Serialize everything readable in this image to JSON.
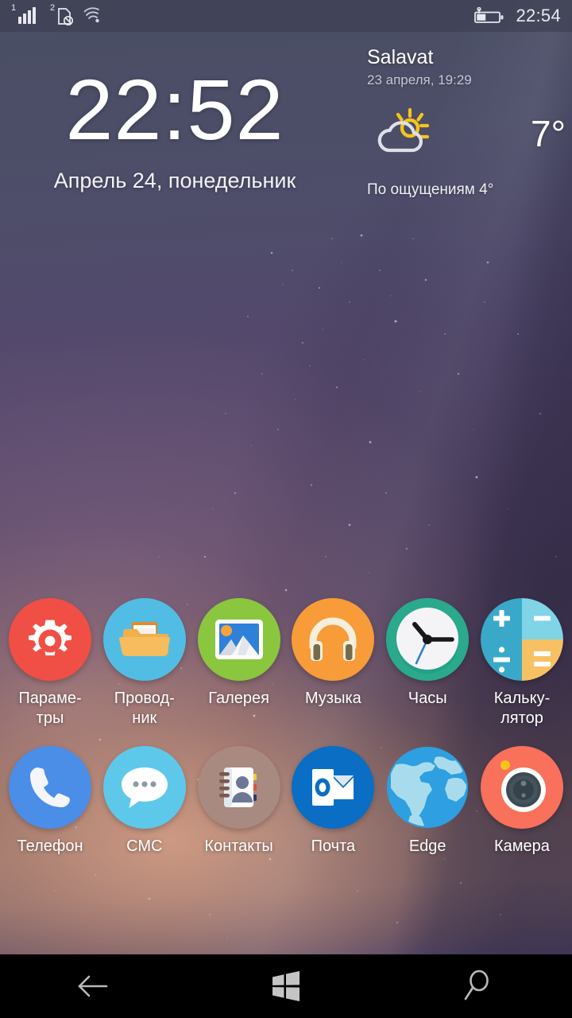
{
  "statusbar": {
    "sim1_label": "1",
    "sim2_label": "2",
    "signal_icon": "signal-bars-icon",
    "sim2_icon": "sim-no-service-icon",
    "wifi_icon": "wifi-icon",
    "battery_icon": "battery-charging-icon",
    "clock": "22:54"
  },
  "lockscreen": {
    "time": "22:52",
    "date": "Апрель 24, понедельник"
  },
  "weather": {
    "city": "Salavat",
    "observed": "23 апреля, 19:29",
    "condition_icon": "partly-cloudy-sun-icon",
    "temperature": "7°",
    "feels_like": "По ощущениям 4°"
  },
  "apps": {
    "row1": [
      {
        "name": "settings",
        "label": "Параме-\nтры",
        "icon": "gear-icon",
        "bg": "#ef4f45"
      },
      {
        "name": "explorer",
        "label": "Провод-\nник",
        "icon": "folder-icon",
        "bg": "#52bde4"
      },
      {
        "name": "gallery",
        "label": "Галерея",
        "icon": "photo-icon",
        "bg": "#8bc63f"
      },
      {
        "name": "music",
        "label": "Музыка",
        "icon": "headphones-icon",
        "bg": "#f79c38"
      },
      {
        "name": "clock",
        "label": "Часы",
        "icon": "analog-clock-icon",
        "bg": "#2aa municipal"
      },
      {
        "name": "calculator",
        "label": "Кальку-\nлятор",
        "icon": "calculator-icon",
        "bg": "#3fb2d6"
      }
    ],
    "row2": [
      {
        "name": "phone",
        "label": "Телефон",
        "icon": "phone-handset-icon",
        "bg": "#4a8ee8"
      },
      {
        "name": "sms",
        "label": "СМС",
        "icon": "chat-bubble-icon",
        "bg": "#5ec8ea"
      },
      {
        "name": "contacts",
        "label": "Контакты",
        "icon": "address-book-icon",
        "bg": "#a98a80"
      },
      {
        "name": "mail",
        "label": "Почта",
        "icon": "outlook-icon",
        "bg": "#0a6ec4"
      },
      {
        "name": "edge",
        "label": "Edge",
        "icon": "globe-icon",
        "bg": "#2e9fe0"
      },
      {
        "name": "camera",
        "label": "Камера",
        "icon": "camera-lens-icon",
        "bg": "#f9705b"
      }
    ]
  },
  "navbar": {
    "back_label": "back-arrow-icon",
    "home_label": "windows-logo-icon",
    "search_label": "search-icon"
  },
  "colors": {
    "nav_bg": "#000000",
    "status_text": "#e8e9ef",
    "label_text": "#ffffff",
    "sun_yellow": "#f5c518"
  }
}
